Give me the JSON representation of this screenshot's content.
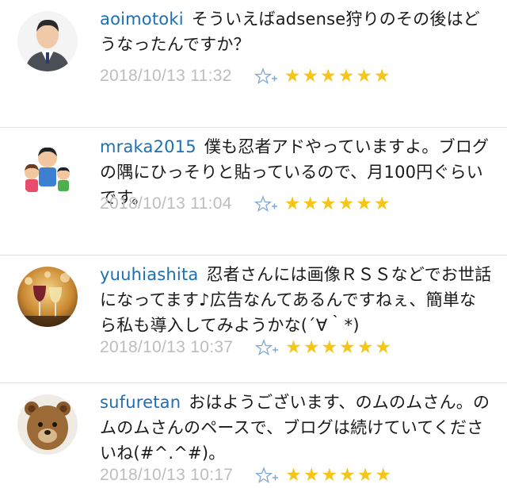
{
  "comments": [
    {
      "username": "aoimotoki",
      "text": "そういえばadsense狩りのその後はどうなったんですか？",
      "timestamp": "2018/10/13 11:32",
      "star_count": 6,
      "avatar_icon": "man-in-suit-avatar"
    },
    {
      "username": "mraka2015",
      "text": "僕も忍者アドやっていますよ。ブログの隅にひっそりと貼っているので、月100円ぐらいです。",
      "timestamp": "2018/10/13 11:04",
      "star_count": 6,
      "avatar_icon": "family-illustration-avatar"
    },
    {
      "username": "yuuhiashita",
      "text": "忍者さんには画像ＲＳＳなどでお世話になってます♪広告なんてあるんですねぇ、簡単なら私も導入してみようかな(´∀｀*)",
      "timestamp": "2018/10/13 10:37",
      "star_count": 6,
      "avatar_icon": "wine-glasses-avatar"
    },
    {
      "username": "sufuretan",
      "text": "おはようございます、のムのムさん。のムのムさんのペースで、ブログは続けていてくださいね(#^.^#)。",
      "timestamp": "2018/10/13 10:17",
      "star_count": 6,
      "avatar_icon": "teddy-bear-avatar"
    }
  ],
  "star_glyph": "★",
  "colors": {
    "username": "#1c6fb5",
    "timestamp": "#bdbdbd",
    "star": "#f5c518",
    "add_star": "#7fa8d6"
  }
}
